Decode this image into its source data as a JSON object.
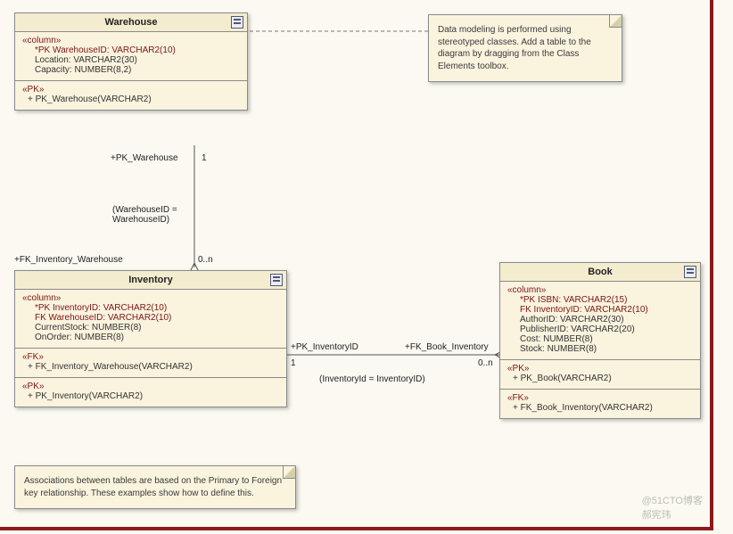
{
  "entities": {
    "warehouse": {
      "title": "Warehouse",
      "section_col": "«column»",
      "cols": [
        {
          "text": "*PK  WarehouseID:  VARCHAR2(10)",
          "key": true
        },
        {
          "text": "Location:  VARCHAR2(30)",
          "key": false
        },
        {
          "text": "Capacity:  NUMBER(8,2)",
          "key": false
        }
      ],
      "section_pk": "«PK»",
      "pk_method": "+    PK_Warehouse(VARCHAR2)"
    },
    "inventory": {
      "title": "Inventory",
      "section_col": "«column»",
      "cols": [
        {
          "text": "*PK  InventoryID:  VARCHAR2(10)",
          "key": true
        },
        {
          "text": " FK  WarehouseID:  VARCHAR2(10)",
          "key": true
        },
        {
          "text": "CurrentStock:  NUMBER(8)",
          "key": false
        },
        {
          "text": "OnOrder:  NUMBER(8)",
          "key": false
        }
      ],
      "section_fk": "«FK»",
      "fk_method": "+    FK_Inventory_Warehouse(VARCHAR2)",
      "section_pk": "«PK»",
      "pk_method": "+    PK_Inventory(VARCHAR2)"
    },
    "book": {
      "title": "Book",
      "section_col": "«column»",
      "cols": [
        {
          "text": "*PK  ISBN:  VARCHAR2(15)",
          "key": true
        },
        {
          "text": " FK  InventoryID:  VARCHAR2(10)",
          "key": true
        },
        {
          "text": "AuthorID:  VARCHAR2(30)",
          "key": false
        },
        {
          "text": "PublisherID:  VARCHAR2(20)",
          "key": false
        },
        {
          "text": "Cost:  NUMBER(8)",
          "key": false
        },
        {
          "text": "Stock:  NUMBER(8)",
          "key": false
        }
      ],
      "section_pk": "«PK»",
      "pk_method": "+    PK_Book(VARCHAR2)",
      "section_fk": "«FK»",
      "fk_method": "+    FK_Book_Inventory(VARCHAR2)"
    }
  },
  "notes": {
    "top": "Data modeling is performed using stereotyped classes. Add a table to the diagram by dragging from the Class Elements toolbox.",
    "bottom": "Associations between tables are based on the Primary to Foreign key relationship. These examples show how to define this."
  },
  "connectors": {
    "wh_inv": {
      "role_pk": "+PK_Warehouse",
      "mult_one": "1",
      "join": "(WarehouseID =\nWarehouseID)",
      "role_fk": "+FK_Inventory_Warehouse",
      "mult_many": "0..n"
    },
    "inv_book": {
      "role_pk": "+PK_InventoryID",
      "mult_one": "1",
      "join": "(InventoryId = InventoryID)",
      "role_fk": "+FK_Book_Inventory",
      "mult_many": "0..n"
    }
  },
  "watermarks": {
    "site": "@51CTO博客",
    "author": "郝宪玮"
  }
}
